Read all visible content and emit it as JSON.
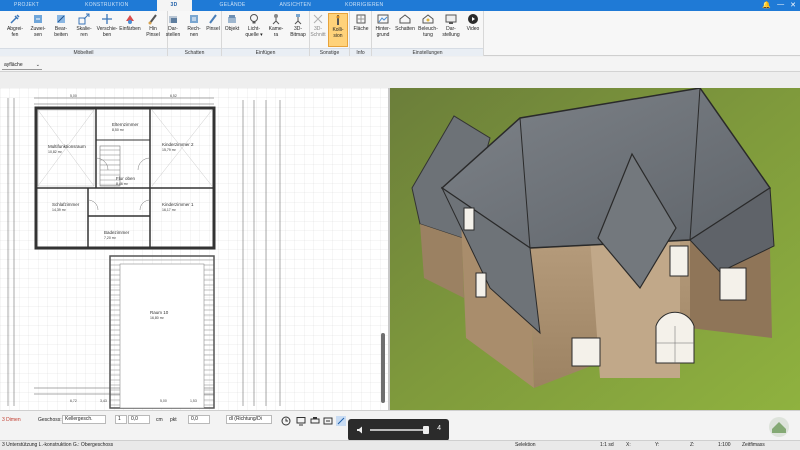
{
  "tabs": [
    "PROJEKT",
    "KONSTRUKTION",
    "3D",
    "GELÄNDE",
    "ANSICHTEN",
    "KORRIGIEREN"
  ],
  "active_tab": "3D",
  "window": {
    "icons": [
      "bell-icon",
      "minimize-icon",
      "close-icon"
    ]
  },
  "ribbon": {
    "groups": [
      {
        "label": "Möbelteil",
        "tools": [
          {
            "label": "Abgrei-\nfen",
            "icon": "pipette-icon"
          },
          {
            "label": "Zuwei-\nsen",
            "icon": "assign-icon"
          },
          {
            "label": "Bear-\nbeiten",
            "icon": "edit-icon"
          },
          {
            "label": "Skalie-\nren",
            "icon": "scale-icon"
          },
          {
            "label": "Verschie-\nben",
            "icon": "move-icon"
          },
          {
            "label": "Einfärben",
            "icon": "paint-icon"
          },
          {
            "label": "Hin\nPinsel",
            "icon": "brush-icon"
          }
        ]
      },
      {
        "label": "Schatten",
        "tools": [
          {
            "label": "Dar-\nstellen",
            "icon": "shade-icon"
          },
          {
            "label": "Rech-\nnen",
            "icon": "calc-icon"
          },
          {
            "label": "Pinsel",
            "icon": "brush2-icon"
          }
        ]
      },
      {
        "label": "Einfügen",
        "tools": [
          {
            "label": "Objekt",
            "icon": "object-icon"
          },
          {
            "label": "Licht-\nquelle ▾",
            "icon": "light-icon"
          },
          {
            "label": "Kame-\nra",
            "icon": "camera-icon"
          },
          {
            "label": "3D-\nBitmap",
            "icon": "bitmap-icon"
          }
        ]
      },
      {
        "label": "Sonstige",
        "tools": [
          {
            "label": "3D-\nSchnitt",
            "icon": "cut-icon"
          },
          {
            "label": "Kolli-\nsion",
            "icon": "collision-icon",
            "active": true
          }
        ]
      },
      {
        "label": "Info",
        "tools": [
          {
            "label": "Fläche",
            "icon": "area-icon"
          }
        ]
      },
      {
        "label": "Einstellungen",
        "tools": [
          {
            "label": "Hinter-\ngrund",
            "icon": "background-icon"
          },
          {
            "label": "Schatten",
            "icon": "house-shadow-icon"
          },
          {
            "label": "Beleuch-\ntung",
            "icon": "lighting-icon"
          },
          {
            "label": "Dar-\nstellung",
            "icon": "display-icon"
          },
          {
            "label": "Video",
            "icon": "video-icon"
          }
        ]
      }
    ]
  },
  "view_select": "ayfläche",
  "floorplan": {
    "rooms": [
      {
        "name": "Elternzimmer",
        "area": "8,50 m²"
      },
      {
        "name": "Multifunktionsraum",
        "area": "10,82 m²"
      },
      {
        "name": "Kinderzimmer 2",
        "area": "15,79 m²"
      },
      {
        "name": "Flur oben",
        "area": "8,46 m²"
      },
      {
        "name": "Schlafzimmer",
        "area": "14,39 m²"
      },
      {
        "name": "Kinderzimmer 1",
        "area": "16,17 m²"
      },
      {
        "name": "Badezimmer",
        "area": "7,20 m²"
      },
      {
        "name": "Raum 10",
        "area": "16,80 m²"
      }
    ],
    "dims": [
      "5,00",
      "6,52",
      "6,72",
      "3,43",
      "5,00",
      "1,53"
    ]
  },
  "bottom": {
    "dimension_label": "3 Dimen",
    "geschoss_label": "Geschoss:",
    "geschoss_value": "Kellergesch.",
    "field1": "1",
    "field2": "0,0",
    "unit1": "cm",
    "unit2": "pkt",
    "field3": "0,0",
    "direction_value": "dl (Richtung/Di"
  },
  "floatbar": {
    "value": "4"
  },
  "status": {
    "left": "3 Unterstützung L.-konstruktion G.: Obergeschoss",
    "selektion": "Selektion",
    "scale1": "1:1 sd",
    "x": "X:",
    "y": "Y:",
    "z": "Z:",
    "scale2": "1:100",
    "mode": "Zeitfimass"
  }
}
